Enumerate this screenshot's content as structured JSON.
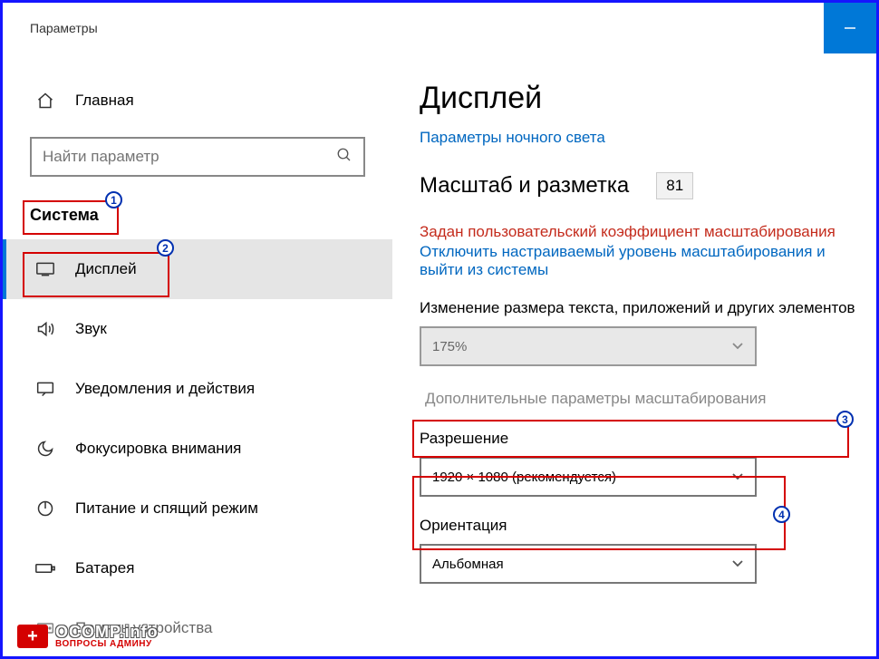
{
  "window": {
    "title": "Параметры"
  },
  "sidebar": {
    "home_label": "Главная",
    "search_placeholder": "Найти параметр",
    "section_title": "Система",
    "items": [
      {
        "label": "Дисплей"
      },
      {
        "label": "Звук"
      },
      {
        "label": "Уведомления и действия"
      },
      {
        "label": "Фокусировка внимания"
      },
      {
        "label": "Питание и спящий режим"
      },
      {
        "label": "Батарея"
      },
      {
        "label": "Память устройства"
      }
    ]
  },
  "content": {
    "heading": "Дисплей",
    "night_light_link": "Параметры ночного света",
    "scale_heading": "Масштаб и разметка",
    "scale_custom_value": "81",
    "warn_text": "Задан пользовательский коэффициент масштабирования",
    "signout_link": "Отключить настраиваемый уровень масштабирования и выйти из системы",
    "scale_label": "Изменение размера текста, приложений и других элементов",
    "scale_value": "175%",
    "advanced_link": "Дополнительные параметры масштабирования",
    "resolution_label": "Разрешение",
    "resolution_value": "1920 × 1080 (рекомендуется)",
    "orientation_label": "Ориентация",
    "orientation_value": "Альбомная"
  },
  "badges": [
    "1",
    "2",
    "3",
    "4"
  ],
  "watermark": {
    "main": "OCOMP.info",
    "sub": "ВОПРОСЫ АДМИНУ"
  }
}
